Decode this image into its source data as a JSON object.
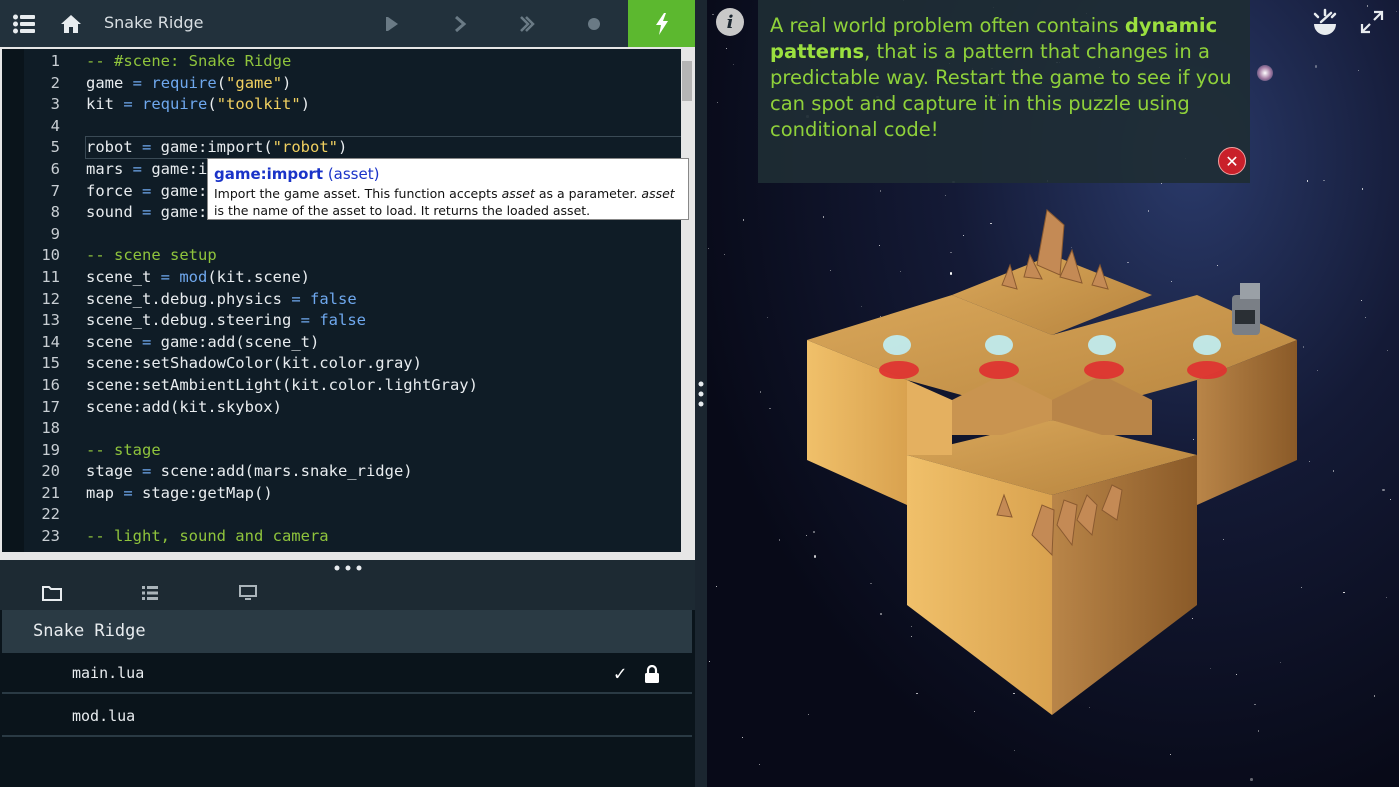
{
  "toolbar": {
    "title": "Snake Ridge"
  },
  "editor": {
    "lines": [
      {
        "n": "1",
        "parts": [
          [
            "cm",
            "-- #scene: Snake Ridge"
          ]
        ]
      },
      {
        "n": "2",
        "parts": [
          [
            "",
            "game "
          ],
          [
            "op",
            "="
          ],
          [
            "",
            " "
          ],
          [
            "fn",
            "require"
          ],
          [
            "",
            "("
          ],
          [
            "st",
            "\"game\""
          ],
          [
            "",
            ")"
          ]
        ]
      },
      {
        "n": "3",
        "parts": [
          [
            "",
            "kit "
          ],
          [
            "op",
            "="
          ],
          [
            "",
            " "
          ],
          [
            "fn",
            "require"
          ],
          [
            "",
            "("
          ],
          [
            "st",
            "\"toolkit\""
          ],
          [
            "",
            ")"
          ]
        ]
      },
      {
        "n": "4",
        "parts": [
          [
            "",
            ""
          ]
        ]
      },
      {
        "n": "5",
        "parts": [
          [
            "",
            "robot "
          ],
          [
            "op",
            "="
          ],
          [
            "",
            " game:import("
          ],
          [
            "st",
            "\"robot\""
          ],
          [
            "",
            ")"
          ]
        ]
      },
      {
        "n": "6",
        "parts": [
          [
            "",
            "mars "
          ],
          [
            "op",
            "="
          ],
          [
            "",
            " game:i"
          ]
        ]
      },
      {
        "n": "7",
        "parts": [
          [
            "",
            "force "
          ],
          [
            "op",
            "="
          ],
          [
            "",
            " game:"
          ]
        ]
      },
      {
        "n": "8",
        "parts": [
          [
            "",
            "sound "
          ],
          [
            "op",
            "="
          ],
          [
            "",
            " game:"
          ]
        ]
      },
      {
        "n": "9",
        "parts": [
          [
            "",
            ""
          ]
        ]
      },
      {
        "n": "10",
        "parts": [
          [
            "cm",
            "-- scene setup"
          ]
        ]
      },
      {
        "n": "11",
        "parts": [
          [
            "",
            "scene_t "
          ],
          [
            "op",
            "="
          ],
          [
            "",
            " "
          ],
          [
            "fn",
            "mod"
          ],
          [
            "",
            "(kit.scene)"
          ]
        ]
      },
      {
        "n": "12",
        "parts": [
          [
            "",
            "scene_t.debug.physics "
          ],
          [
            "op",
            "="
          ],
          [
            "",
            " "
          ],
          [
            "kw",
            "false"
          ]
        ]
      },
      {
        "n": "13",
        "parts": [
          [
            "",
            "scene_t.debug.steering "
          ],
          [
            "op",
            "="
          ],
          [
            "",
            " "
          ],
          [
            "kw",
            "false"
          ]
        ]
      },
      {
        "n": "14",
        "parts": [
          [
            "",
            "scene "
          ],
          [
            "op",
            "="
          ],
          [
            "",
            " game:add(scene_t)"
          ]
        ]
      },
      {
        "n": "15",
        "parts": [
          [
            "",
            "scene:setShadowColor(kit.color.gray)"
          ]
        ]
      },
      {
        "n": "16",
        "parts": [
          [
            "",
            "scene:setAmbientLight(kit.color.lightGray)"
          ]
        ]
      },
      {
        "n": "17",
        "parts": [
          [
            "",
            "scene:add(kit.skybox)"
          ]
        ]
      },
      {
        "n": "18",
        "parts": [
          [
            "",
            ""
          ]
        ]
      },
      {
        "n": "19",
        "parts": [
          [
            "cm",
            "-- stage"
          ]
        ]
      },
      {
        "n": "20",
        "parts": [
          [
            "",
            "stage "
          ],
          [
            "op",
            "="
          ],
          [
            "",
            " scene:add(mars.snake_ridge)"
          ]
        ]
      },
      {
        "n": "21",
        "parts": [
          [
            "",
            "map "
          ],
          [
            "op",
            "="
          ],
          [
            "",
            " stage:getMap()"
          ]
        ]
      },
      {
        "n": "22",
        "parts": [
          [
            "",
            ""
          ]
        ]
      },
      {
        "n": "23",
        "parts": [
          [
            "cm",
            "-- light, sound and camera"
          ]
        ]
      }
    ]
  },
  "tooltip": {
    "name": "game:import",
    "param": "(asset)",
    "desc_a": "Import the game asset. This function accepts ",
    "desc_em1": "asset",
    "desc_b": " as a parameter. ",
    "desc_em2": "asset",
    "desc_c": " is the name of the asset to load. It returns the loaded asset."
  },
  "files": {
    "folder": "Snake Ridge",
    "items": [
      {
        "name": "main.lua"
      },
      {
        "name": "mod.lua"
      }
    ]
  },
  "message": {
    "pre": "A real world problem often contains ",
    "bold": "dynamic patterns",
    "post": ", that is a pattern that changes in a predictable way. Restart the game to see if you can spot and capture it in this puzzle using conditional code!"
  },
  "icons": {
    "menu": "menu-icon",
    "home": "home-icon",
    "play": "play-icon",
    "step": "step-icon",
    "step-fast": "step-fast-icon",
    "record": "record-icon",
    "run": "lightning-icon",
    "info": "info-icon",
    "close": "close-icon",
    "brightness": "brightness-icon",
    "fullscreen": "fullscreen-icon"
  },
  "colors": {
    "accent_green": "#5cb82f",
    "message_text": "#8fd13a",
    "close_red": "#c9202a"
  }
}
